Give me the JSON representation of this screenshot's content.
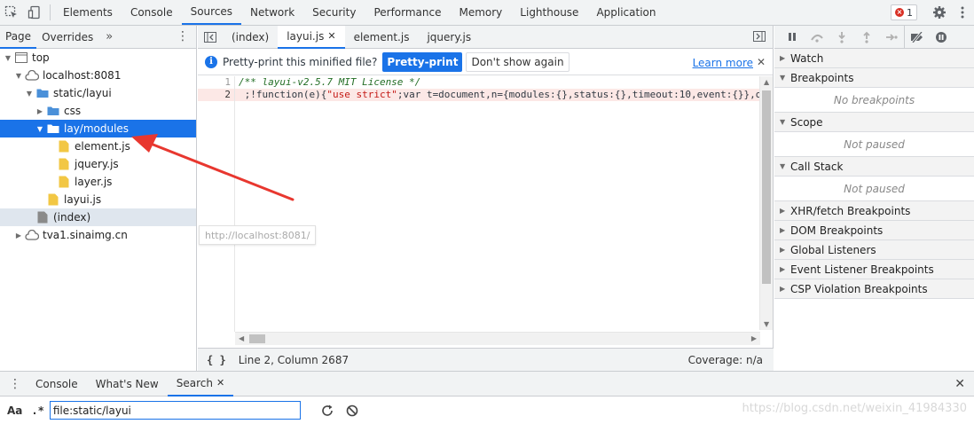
{
  "topbar": {
    "tabs": [
      "Elements",
      "Console",
      "Sources",
      "Network",
      "Security",
      "Performance",
      "Memory",
      "Lighthouse",
      "Application"
    ],
    "active_tab": "Sources",
    "error_count": "1"
  },
  "navigator": {
    "tabs": [
      "Page",
      "Overrides"
    ],
    "more": "»",
    "tree": [
      {
        "label": "top",
        "depth": 0,
        "icon": "frame-icon",
        "arrow": "▼"
      },
      {
        "label": "localhost:8081",
        "depth": 1,
        "icon": "cloud-icon",
        "arrow": "▼"
      },
      {
        "label": "static/layui",
        "depth": 2,
        "icon": "folder-icon",
        "arrow": "▼"
      },
      {
        "label": "css",
        "depth": 3,
        "icon": "folder-icon",
        "arrow": "▶"
      },
      {
        "label": "lay/modules",
        "depth": 3,
        "icon": "folder-icon",
        "arrow": "▼"
      },
      {
        "label": "element.js",
        "depth": 4,
        "icon": "js-file-icon",
        "arrow": ""
      },
      {
        "label": "jquery.js",
        "depth": 4,
        "icon": "js-file-icon",
        "arrow": ""
      },
      {
        "label": "layer.js",
        "depth": 4,
        "icon": "js-file-icon",
        "arrow": ""
      },
      {
        "label": "layui.js",
        "depth": 3,
        "icon": "js-file-icon",
        "arrow": ""
      },
      {
        "label": "(index)",
        "depth": 2,
        "icon": "document-icon",
        "arrow": ""
      },
      {
        "label": "tva1.sinaimg.cn",
        "depth": 1,
        "icon": "cloud-icon",
        "arrow": "▶"
      }
    ],
    "tooltip": "http://localhost:8081/"
  },
  "editor": {
    "tabs": [
      {
        "label": "(index)",
        "closable": false
      },
      {
        "label": "layui.js",
        "closable": true
      },
      {
        "label": "element.js",
        "closable": false
      },
      {
        "label": "jquery.js",
        "closable": false
      }
    ],
    "infobar": {
      "message": "Pretty-print this minified file?",
      "pretty_print": "Pretty-print",
      "dont_show": "Don't show again",
      "learn_more": "Learn more"
    },
    "line_numbers": [
      "1",
      "2"
    ],
    "code_line1": "/** layui-v2.5.7 MIT License */",
    "code_line2_pre": " ;!function(e){",
    "code_line2_str": "\"use strict\"",
    "code_line2_post": ";var t=document,n={modules:{},status:{},timeout:10,event:{}},o",
    "status_position": "Line 2, Column 2687",
    "coverage": "Coverage: n/a"
  },
  "debugger": {
    "sections": [
      {
        "title": "Watch",
        "arrow": "▶",
        "body": ""
      },
      {
        "title": "Breakpoints",
        "arrow": "▼",
        "body": "No breakpoints"
      },
      {
        "title": "Scope",
        "arrow": "▼",
        "body": "Not paused"
      },
      {
        "title": "Call Stack",
        "arrow": "▼",
        "body": "Not paused"
      },
      {
        "title": "XHR/fetch Breakpoints",
        "arrow": "▶",
        "body": ""
      },
      {
        "title": "DOM Breakpoints",
        "arrow": "▶",
        "body": ""
      },
      {
        "title": "Global Listeners",
        "arrow": "▶",
        "body": ""
      },
      {
        "title": "Event Listener Breakpoints",
        "arrow": "▶",
        "body": ""
      },
      {
        "title": "CSP Violation Breakpoints",
        "arrow": "▶",
        "body": ""
      }
    ]
  },
  "drawer": {
    "tabs": [
      {
        "label": "Console",
        "closable": false
      },
      {
        "label": "What's New",
        "closable": false
      },
      {
        "label": "Search",
        "closable": true
      }
    ],
    "match_case": "Aa",
    "regex": ".*",
    "search_value": "file:static/layui"
  },
  "watermark": "https://blog.csdn.net/weixin_41984330",
  "colors": {
    "accent": "#1a73e8",
    "annotation_arrow": "#e8372f",
    "folder": "#4a90d9",
    "js_file": "#f2c744"
  }
}
